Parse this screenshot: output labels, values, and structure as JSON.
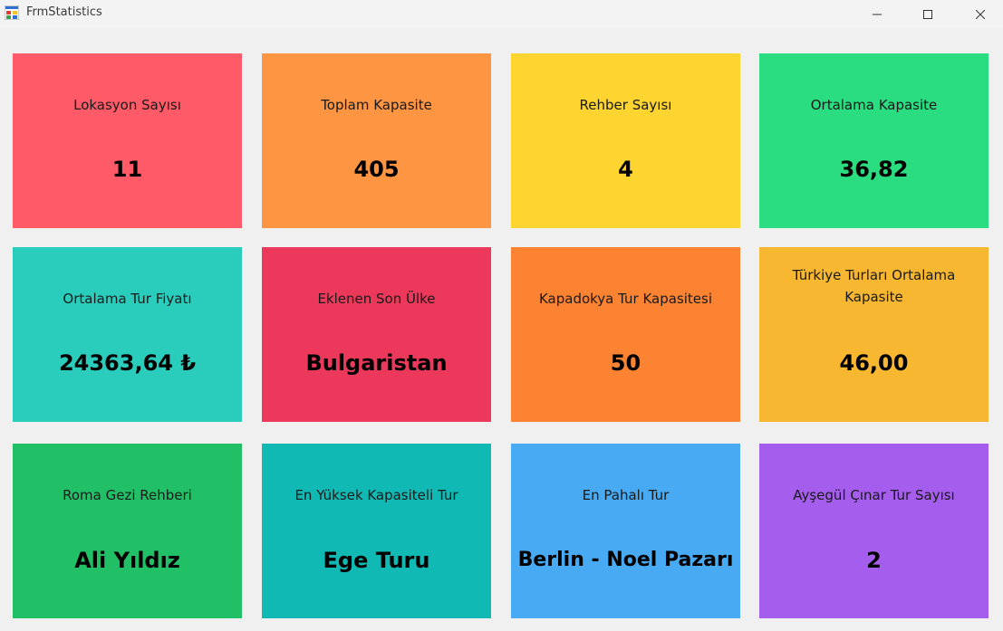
{
  "window": {
    "title": "FrmStatistics"
  },
  "tiles": [
    {
      "label": "Lokasyon Sayısı",
      "value": "11",
      "color": "#fe5a68"
    },
    {
      "label": "Toplam Kapasite",
      "value": "405",
      "color": "#fe9543"
    },
    {
      "label": "Rehber Sayısı",
      "value": "4",
      "color": "#fed430"
    },
    {
      "label": "Ortalama Kapasite",
      "value": "36,82",
      "color": "#29dd80"
    },
    {
      "label": "Ortalama Tur Fiyatı",
      "value": "24363,64 ₺",
      "color": "#2acdbc"
    },
    {
      "label": "Eklenen Son Ülke",
      "value": "Bulgaristan",
      "color": "#ec395b"
    },
    {
      "label": "Kapadokya Tur Kapasitesi",
      "value": "50",
      "color": "#fc8332"
    },
    {
      "label": "Türkiye Turları Ortalama Kapasite",
      "value": "46,00",
      "color": "#f7b731"
    },
    {
      "label": "Roma Gezi Rehberi",
      "value": "Ali Yıldız",
      "color": "#22c066"
    },
    {
      "label": "En Yüksek Kapasiteli Tur",
      "value": "Ege Turu",
      "color": "#10b9b3"
    },
    {
      "label": "En Pahalı Tur",
      "value": "Berlin - Noel Pazarı",
      "color": "#47aaf3"
    },
    {
      "label": "Ayşegül Çınar Tur Sayısı",
      "value": "2",
      "color": "#a45ded"
    }
  ]
}
